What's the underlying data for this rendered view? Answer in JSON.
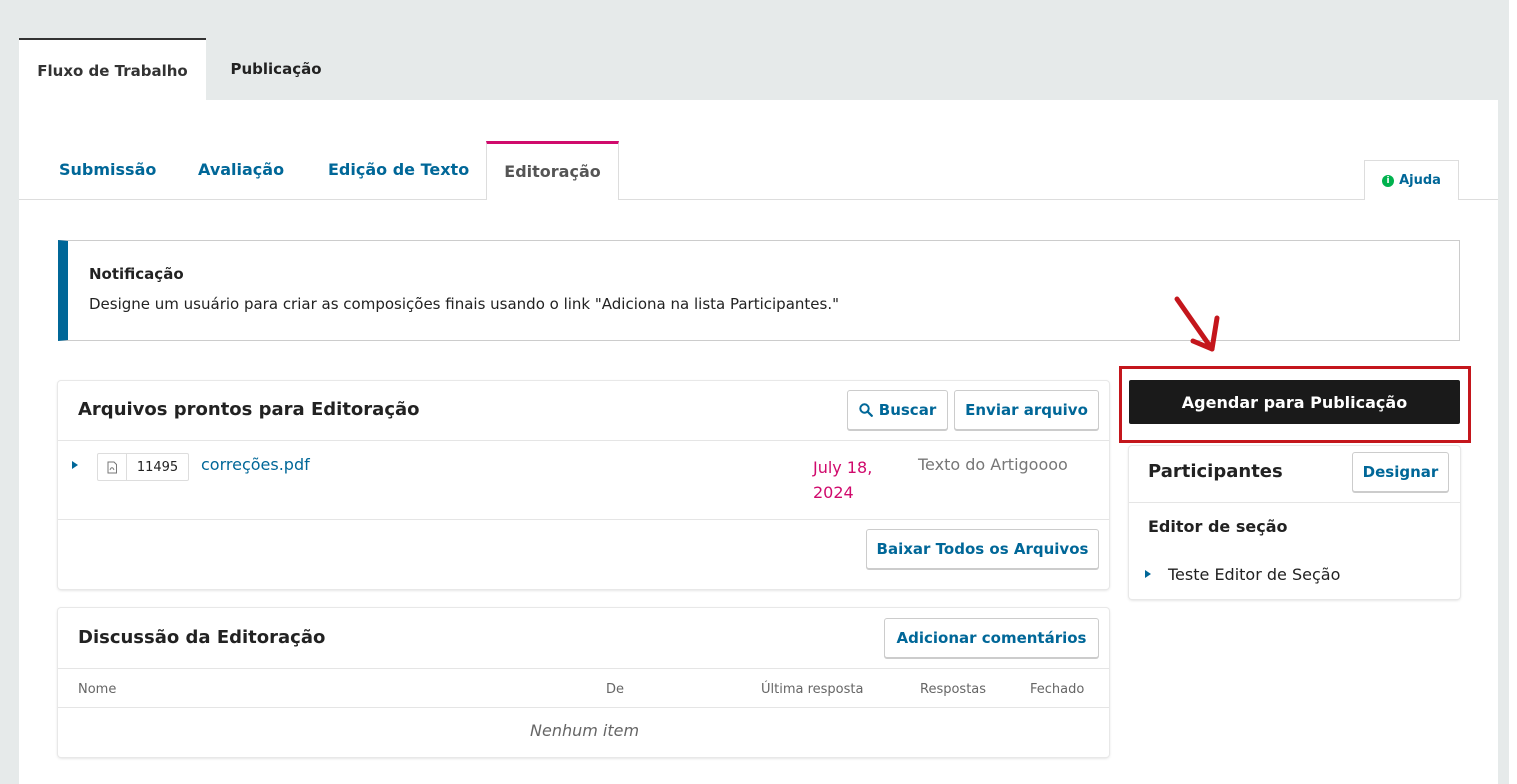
{
  "top_tabs": {
    "workflow": "Fluxo de Trabalho",
    "publication": "Publicação"
  },
  "stage_tabs": [
    "Submissão",
    "Avaliação",
    "Edição de Texto",
    "Editoração"
  ],
  "help": {
    "label": "Ajuda",
    "icon": "info-icon"
  },
  "notification": {
    "title": "Notificação",
    "text": "Designe um usuário para criar as composições finais usando o link \"Adiciona na lista Participantes.\""
  },
  "files_panel": {
    "title": "Arquivos prontos para Editoração",
    "search_label": "Buscar",
    "upload_label": "Enviar arquivo",
    "download_all_label": "Baixar Todos os Arquivos",
    "files": [
      {
        "id": "11495",
        "name": "correções.pdf",
        "date": "July 18, 2024",
        "genre": "Texto do Artigoooo",
        "icon": "pdf-file-icon"
      }
    ]
  },
  "discussion_panel": {
    "title": "Discussão da Editoração",
    "add_label": "Adicionar comentários",
    "columns": [
      "Nome",
      "De",
      "Última resposta",
      "Respostas",
      "Fechado"
    ],
    "empty_text": "Nenhum item"
  },
  "sidebar": {
    "schedule_label": "Agendar para Publicação",
    "participants_title": "Participantes",
    "assign_label": "Designar",
    "group_title": "Editor de seção",
    "members": [
      "Teste Editor de Seção"
    ]
  },
  "colors": {
    "link": "#006798",
    "active_tab_accent": "#d00a6c",
    "annotation_red": "#c4161c",
    "primary_button": "#1a1a1a"
  }
}
